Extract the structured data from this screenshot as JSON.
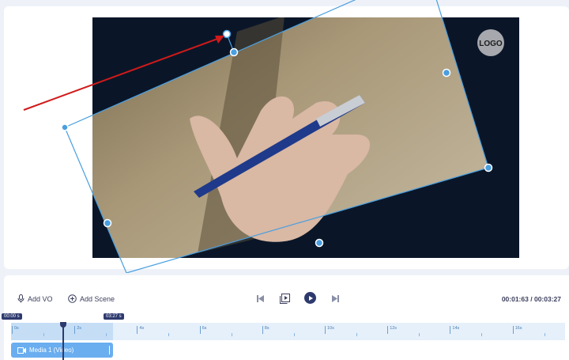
{
  "canvas": {
    "logo_text": "LOGO",
    "video_bg": "#0a1628",
    "selection_color": "#4a9fe0",
    "arrow_color": "#d11a1a"
  },
  "toolbar": {
    "add_vo": "Add VO",
    "add_scene": "Add Scene",
    "time_current": "00:01:63",
    "time_sep": "/",
    "time_total": "00:03:27"
  },
  "timeline": {
    "start_badge": "00:00 s",
    "end_badge": "03:27 s",
    "ticks": [
      "0s",
      "2s",
      "4s",
      "6s",
      "8s",
      "10s",
      "12s",
      "14s",
      "16s"
    ],
    "clip_label": "Media 1 (Video)",
    "accent": "#2e3a6e"
  }
}
